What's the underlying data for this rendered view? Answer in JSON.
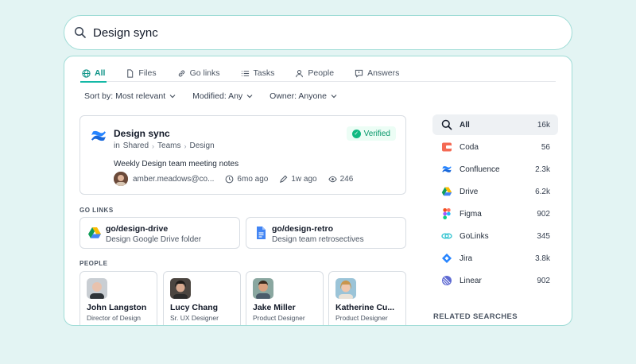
{
  "search": {
    "query": "Design sync"
  },
  "tabs": [
    {
      "label": "All",
      "icon": "globe-icon"
    },
    {
      "label": "Files",
      "icon": "file-icon"
    },
    {
      "label": "Go links",
      "icon": "link-icon"
    },
    {
      "label": "Tasks",
      "icon": "tasks-icon"
    },
    {
      "label": "People",
      "icon": "person-icon"
    },
    {
      "label": "Answers",
      "icon": "answers-icon"
    }
  ],
  "filters": {
    "sort": "Sort by: Most relevant",
    "modified": "Modified: Any",
    "owner": "Owner: Anyone"
  },
  "result": {
    "title": "Design sync",
    "path_prefix": "in",
    "path": [
      "Shared",
      "Teams",
      "Design"
    ],
    "verified": "Verified",
    "description": "Weekly Design team meeting notes",
    "owner": "amber.meadows@co...",
    "created": "6mo ago",
    "edited": "1w ago",
    "views": "246"
  },
  "golinks_section": "GO LINKS",
  "golinks": [
    {
      "title": "go/design-drive",
      "subtitle": "Design Google Drive folder"
    },
    {
      "title": "go/design-retro",
      "subtitle": "Design team retrosectives"
    }
  ],
  "people_section": "PEOPLE",
  "people": [
    {
      "name": "John Langston",
      "role": "Director of Design"
    },
    {
      "name": "Lucy Chang",
      "role": "Sr. UX Designer"
    },
    {
      "name": "Jake Miller",
      "role": "Product Designer"
    },
    {
      "name": "Katherine Cu...",
      "role": "Product Designer"
    }
  ],
  "sources": [
    {
      "label": "All",
      "count": "16k"
    },
    {
      "label": "Coda",
      "count": "56"
    },
    {
      "label": "Confluence",
      "count": "2.3k"
    },
    {
      "label": "Drive",
      "count": "6.2k"
    },
    {
      "label": "Figma",
      "count": "902"
    },
    {
      "label": "GoLinks",
      "count": "345"
    },
    {
      "label": "Jira",
      "count": "3.8k"
    },
    {
      "label": "Linear",
      "count": "902"
    }
  ],
  "related_label": "RELATED SEARCHES",
  "colors": {
    "accent": "#14b8a6",
    "border": "#9fdcd6",
    "background": "#e3f4f3"
  }
}
